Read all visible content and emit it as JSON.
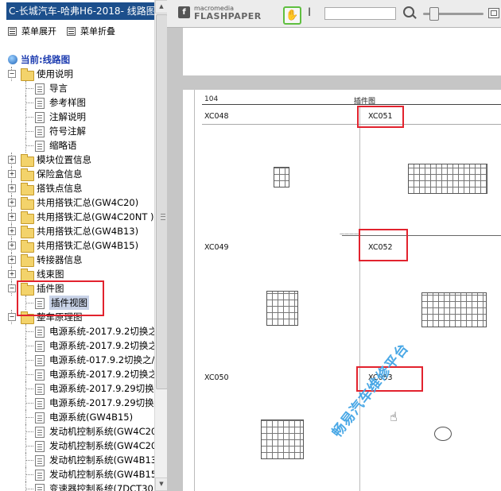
{
  "left_panel": {
    "title": "C-长城汽车-哈弗H6-2018- 线路图.",
    "menu": {
      "expand_label": "菜单展开",
      "collapse_label": "菜单折叠"
    },
    "current_label": "当前:线路图",
    "tree": [
      {
        "label": "使用说明",
        "type": "folder",
        "expander": "−",
        "indent": 0
      },
      {
        "label": "导言",
        "type": "doc",
        "indent": 1
      },
      {
        "label": "参考样图",
        "type": "doc",
        "indent": 1
      },
      {
        "label": "注解说明",
        "type": "doc",
        "indent": 1
      },
      {
        "label": "符号注解",
        "type": "doc",
        "indent": 1
      },
      {
        "label": "缩略语",
        "type": "doc",
        "indent": 1
      },
      {
        "label": "模块位置信息",
        "type": "folder",
        "expander": "+",
        "indent": 0
      },
      {
        "label": "保险盒信息",
        "type": "folder",
        "expander": "+",
        "indent": 0
      },
      {
        "label": "搭铁点信息",
        "type": "folder",
        "expander": "+",
        "indent": 0
      },
      {
        "label": "共用搭铁汇总(GW4C20)",
        "type": "folder",
        "expander": "+",
        "indent": 0
      },
      {
        "label": "共用搭铁汇总(GW4C20NT )",
        "type": "folder",
        "expander": "+",
        "indent": 0
      },
      {
        "label": "共用搭铁汇总(GW4B13)",
        "type": "folder",
        "expander": "+",
        "indent": 0
      },
      {
        "label": "共用搭铁汇总(GW4B15)",
        "type": "folder",
        "expander": "+",
        "indent": 0
      },
      {
        "label": "转接器信息",
        "type": "folder",
        "expander": "+",
        "indent": 0
      },
      {
        "label": "线束图",
        "type": "folder",
        "expander": "+",
        "indent": 0
      },
      {
        "label": "插件图",
        "type": "folder",
        "expander": "−",
        "indent": 0
      },
      {
        "label": "插件视图",
        "type": "doc",
        "indent": 1,
        "selected": true
      },
      {
        "label": "整车原理图",
        "type": "folder",
        "expander": "−",
        "indent": 0
      },
      {
        "label": "电源系统-2017.9.2切换之",
        "type": "doc",
        "indent": 1
      },
      {
        "label": "电源系统-2017.9.2切换之",
        "type": "doc",
        "indent": 1
      },
      {
        "label": "电源系统-017.9.2切换之/",
        "type": "doc",
        "indent": 1
      },
      {
        "label": "电源系统-2017.9.2切换之",
        "type": "doc",
        "indent": 1
      },
      {
        "label": "电源系统-2017.9.29切换",
        "type": "doc",
        "indent": 1
      },
      {
        "label": "电源系统-2017.9.29切换",
        "type": "doc",
        "indent": 1
      },
      {
        "label": "电源系统(GW4B15)",
        "type": "doc",
        "indent": 1
      },
      {
        "label": "发动机控制系统(GW4C20",
        "type": "doc",
        "indent": 1
      },
      {
        "label": "发动机控制系统(GW4C20",
        "type": "doc",
        "indent": 1
      },
      {
        "label": "发动机控制系统(GW4B13",
        "type": "doc",
        "indent": 1
      },
      {
        "label": "发动机控制系统(GW4B15",
        "type": "doc",
        "indent": 1
      },
      {
        "label": "变速器控制系统(7DCT30",
        "type": "doc",
        "indent": 1
      }
    ]
  },
  "viewer": {
    "logo_sub": "macromedia",
    "logo_name": "FLASHPAPER",
    "search_value": "",
    "page": {
      "page_number": "104",
      "header": "插件图",
      "sub_header": "一一一一",
      "connectors": [
        {
          "id": "XC048"
        },
        {
          "id": "XC051"
        },
        {
          "id": "XC049"
        },
        {
          "id": "XC052"
        },
        {
          "id": "XC050"
        },
        {
          "id": "XC053"
        }
      ]
    },
    "watermark": "畅易汽车维修平台"
  },
  "colors": {
    "title_bar": "#1c4f8c",
    "highlight_red": "#e2232e",
    "watermark": "#4aa8e6"
  }
}
